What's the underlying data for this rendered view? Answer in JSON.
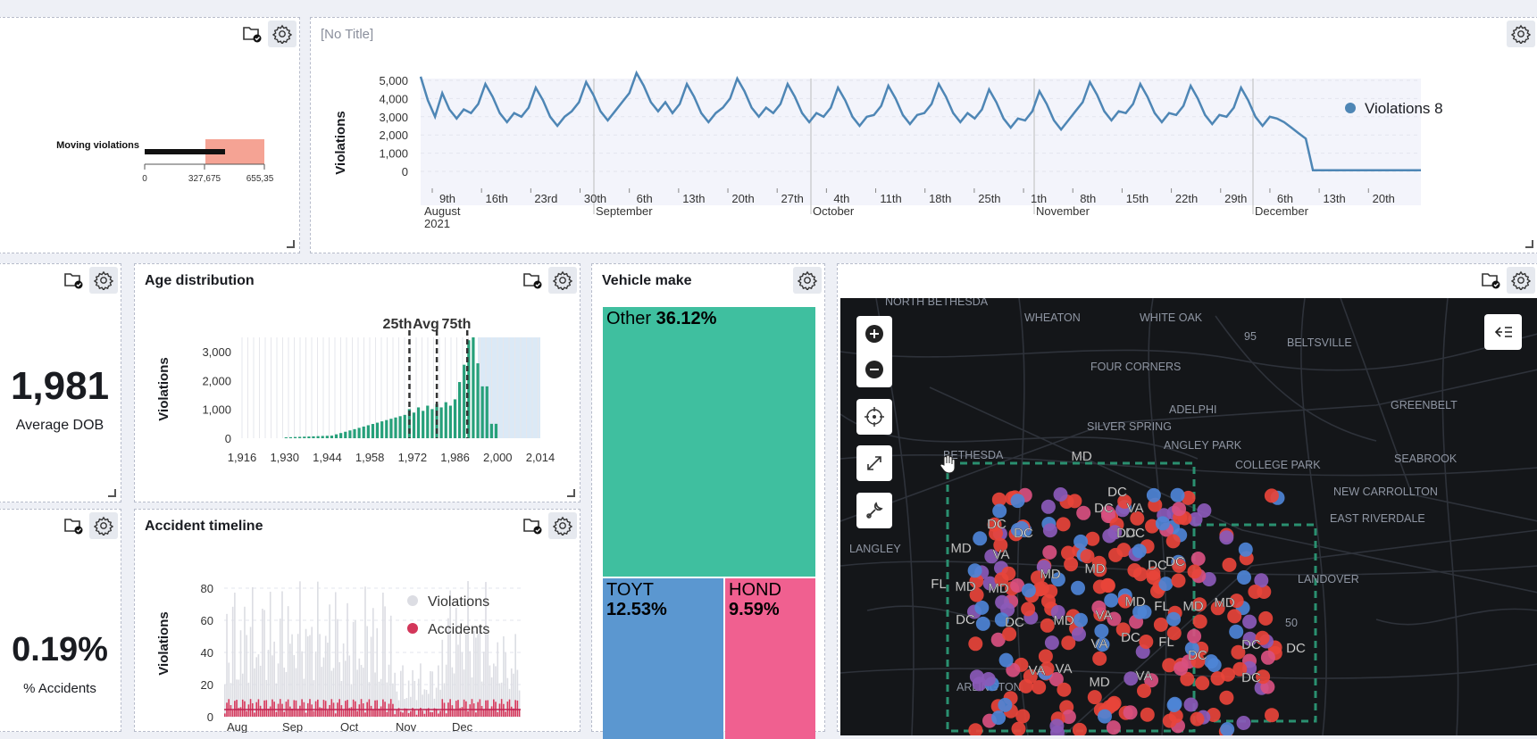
{
  "colors": {
    "line": "#4e86b5",
    "teal": "#3fbf9f",
    "blue": "#5b97d0",
    "pink": "#f06090",
    "green": "#26a07a",
    "accident": "#d3365a",
    "mapbg": "#141619"
  },
  "bullet": {
    "label": "Moving violations",
    "ticks": [
      "0",
      "327,675",
      "655,35"
    ]
  },
  "timeline": {
    "title": "[No Title]",
    "legend": "Violations 8",
    "ylabel": "Violations",
    "yticks": [
      "5,000",
      "4,000",
      "3,000",
      "2,000",
      "1,000",
      "0"
    ],
    "xticks": [
      "9th",
      "16th",
      "23rd",
      "30th",
      "6th",
      "13th",
      "20th",
      "27th",
      "4th",
      "11th",
      "18th",
      "25th",
      "1th",
      "8th",
      "15th",
      "22th",
      "29th",
      "6th",
      "13th",
      "20th"
    ],
    "months": [
      {
        "m": "August",
        "y": "2021"
      },
      {
        "m": "September",
        "y": ""
      },
      {
        "m": "October",
        "y": ""
      },
      {
        "m": "November",
        "y": ""
      },
      {
        "m": "December",
        "y": ""
      }
    ]
  },
  "avgdob": {
    "value": "1,981",
    "label": "Average DOB"
  },
  "accpct": {
    "value": "0.19%",
    "label": "% Accidents"
  },
  "age": {
    "title": "Age distribution",
    "ylabel": "Violations",
    "yticks": [
      "3,000",
      "2,000",
      "1,000",
      "0"
    ],
    "xticks": [
      "1,916",
      "1,930",
      "1,944",
      "1,958",
      "1,972",
      "1,986",
      "2,000",
      "2,014"
    ],
    "markers": [
      "25th",
      "Avg",
      "75th"
    ]
  },
  "acc": {
    "title": "Accident timeline",
    "ylabel": "Violations",
    "yticks": [
      "80",
      "60",
      "40",
      "20",
      "0"
    ],
    "xticks": [
      "Aug",
      "Sep",
      "Oct",
      "Nov",
      "Dec"
    ],
    "legend": [
      "Violations",
      "Accidents"
    ]
  },
  "make": {
    "title": "Vehicle make",
    "items": [
      {
        "name": "Other",
        "pct": "36.12%"
      },
      {
        "name": "TOYT",
        "pct": "12.53%"
      },
      {
        "name": "HOND",
        "pct": "9.59%"
      }
    ]
  },
  "map": {
    "places": [
      "NORTH BETHESDA",
      "WHEATON",
      "WHITE OAK",
      "BELTSVILLE",
      "FOUR CORNERS",
      "95",
      "ADELPHI",
      "GREENBELT",
      "SILVER SPRING",
      "ANGLEY PARK",
      "COLLEGE PARK",
      "SEABROOK",
      "BETHESDA",
      "NEW CARROLLTON",
      "EAST RIVERDALE",
      "LANGLEY",
      "LANDOVER",
      "ARLINGTON",
      "50"
    ],
    "states": [
      "MD",
      "DC",
      "VA",
      "FL"
    ]
  },
  "chart_data": [
    {
      "type": "line",
      "title": "[No Title]",
      "ylabel": "Violations",
      "ylim": [
        0,
        5000
      ],
      "series": [
        {
          "name": "Violations",
          "y_first_weeks": [
            5200,
            3400,
            2800,
            4000,
            5200,
            3300,
            3900,
            4100,
            5200,
            3500,
            3300,
            5200
          ]
        }
      ]
    },
    {
      "type": "bar",
      "title": "Age distribution",
      "ylabel": "Violations",
      "xlim": [
        1916,
        2014
      ],
      "ylim": [
        0,
        3500
      ]
    },
    {
      "type": "bar",
      "title": "Accident timeline",
      "ylabel": "Violations",
      "ylim": [
        0,
        90
      ],
      "series": [
        {
          "name": "Violations"
        },
        {
          "name": "Accidents"
        }
      ]
    },
    {
      "type": "treemap",
      "title": "Vehicle make",
      "categories": [
        "Other",
        "TOYT",
        "HOND"
      ],
      "values": [
        36.12,
        12.53,
        9.59
      ]
    }
  ]
}
